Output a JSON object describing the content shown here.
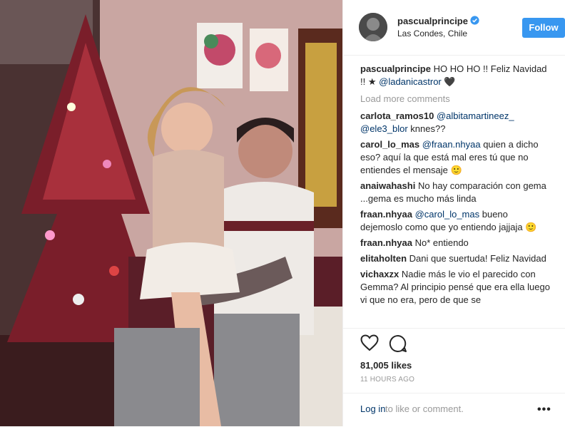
{
  "post": {
    "username": "pascualprincipe",
    "location": "Las Condes, Chile",
    "follow_label": "Follow",
    "caption_text": "HO HO HO !! Feliz Navidad !! ",
    "caption_star": "★",
    "caption_mention": "@ladanicastror",
    "caption_heart": "🖤",
    "load_more": "Load more comments",
    "likes": "81,005 likes",
    "time": "11 HOURS AGO",
    "login_link": "Log in",
    "login_rest": " to like or comment.",
    "more_label": "•••"
  },
  "comments": [
    {
      "user": "carlota_ramos10",
      "mention": "@albitamartineez_ @ele3_blor",
      "text": " knnes??"
    },
    {
      "user": "carol_lo_mas",
      "mention": "@fraan.nhyaa",
      "text": " quien a dicho eso? aquí la que está mal eres tú que no entiendes el mensaje 🙂"
    },
    {
      "user": "anaiwahashi",
      "mention": "",
      "text": "No hay comparación con gema ...gema es mucho más linda"
    },
    {
      "user": "fraan.nhyaa",
      "mention": "@carol_lo_mas",
      "text": " bueno dejemoslo como que yo entiendo jajjaja 🙂"
    },
    {
      "user": "fraan.nhyaa",
      "mention": "",
      "text": "No* entiendo"
    },
    {
      "user": "elitaholten",
      "mention": "",
      "text": "Dani que suertuda! Feliz Navidad"
    },
    {
      "user": "vichaxzx",
      "mention": "",
      "text": "Nadie más le vio el parecido con Gemma? Al principio pensé que era ella luego vi que no era, pero de que se"
    }
  ],
  "colors": {
    "follow": "#3897f0",
    "link": "#003569",
    "muted": "#999999"
  }
}
